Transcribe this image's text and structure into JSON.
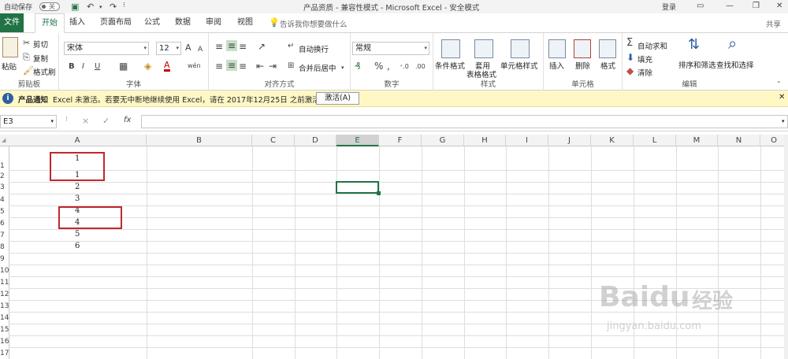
{
  "titlebar": {
    "autosave_label": "自动保存",
    "autosave_state": "关",
    "title": "产品资质  -  兼容性模式  -  Microsoft Excel  -  安全模式",
    "login": "登录"
  },
  "tabs": [
    "文件",
    "开始",
    "插入",
    "页面布局",
    "公式",
    "数据",
    "审阅",
    "视图"
  ],
  "active_tab": "开始",
  "tell_me": "告诉我你想要做什么",
  "share": "共享",
  "clipboard": {
    "paste": "粘贴",
    "cut": "剪切",
    "copy": "复制",
    "format_painter": "格式刷",
    "group": "剪贴板"
  },
  "font": {
    "name": "宋体",
    "size": "12",
    "bold": "B",
    "italic": "I",
    "underline": "U",
    "grow": "A",
    "shrink": "A",
    "font_color": "A",
    "phonetic": "wén",
    "group": "字体"
  },
  "alignment": {
    "wrap": "自动换行",
    "merge": "合并后居中",
    "group": "对齐方式"
  },
  "number": {
    "format": "常规",
    "percent": "%",
    "comma": ",",
    "group": "数字"
  },
  "styles": {
    "conditional": "条件格式",
    "table_format_line1": "套用",
    "table_format_line2": "表格格式",
    "cell_styles": "单元格样式",
    "group": "样式"
  },
  "cells": {
    "insert": "插入",
    "delete": "删除",
    "format": "格式",
    "group": "单元格"
  },
  "editing": {
    "autosum": "自动求和",
    "fill": "填充",
    "clear": "清除",
    "sort": "排序和筛选",
    "find": "查找和选择",
    "group": "编辑"
  },
  "notification": {
    "title": "产品通知",
    "message": "Excel 未激活。若要无中断地继续使用 Excel，请在 2017年12月25日 之前激活。",
    "button": "激活(A)"
  },
  "formula_bar": {
    "name_box": "E3",
    "cancel": "×",
    "enter": "✓",
    "fx": "fx",
    "value": ""
  },
  "columns": [
    "A",
    "B",
    "C",
    "D",
    "E",
    "F",
    "G",
    "H",
    "I",
    "J",
    "K",
    "L",
    "M",
    "N",
    "O"
  ],
  "selected_column": "E",
  "rows": [
    "1",
    "2",
    "3",
    "4",
    "5",
    "6",
    "7",
    "8",
    "9",
    "10",
    "11",
    "12",
    "13",
    "14",
    "15",
    "16",
    "17"
  ],
  "cells_a": [
    "1",
    "1",
    "2",
    "3",
    "4",
    "4",
    "5",
    "6"
  ],
  "watermark": {
    "brand": "Baidu",
    "cn": "经验",
    "url": "jingyan.baidu.com"
  },
  "colors": {
    "accent": "#217346",
    "highlight_box": "#c0282d",
    "notification_bg": "#fff8c5"
  }
}
